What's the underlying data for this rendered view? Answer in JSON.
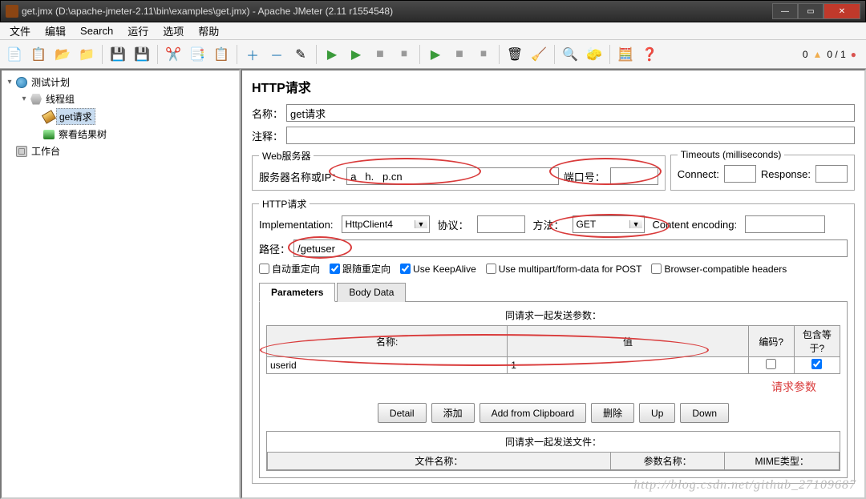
{
  "titlebar": {
    "text": "get.jmx (D:\\apache-jmeter-2.11\\bin\\examples\\get.jmx) - Apache JMeter (2.11 r1554548)"
  },
  "menubar": [
    "文件",
    "编辑",
    "Search",
    "运行",
    "选项",
    "帮助"
  ],
  "status": {
    "warn_count": "0",
    "err_count": "0 / 1"
  },
  "tree": {
    "nodes": [
      {
        "label": "测试计划",
        "indent": 0,
        "icon": "plan",
        "expanded": true
      },
      {
        "label": "线程组",
        "indent": 1,
        "icon": "thread",
        "expanded": true
      },
      {
        "label": "get请求",
        "indent": 2,
        "icon": "sampler",
        "selected": true
      },
      {
        "label": "察看结果树",
        "indent": 2,
        "icon": "listener"
      },
      {
        "label": "工作台",
        "indent": 0,
        "icon": "workbench"
      }
    ]
  },
  "page": {
    "title": "HTTP请求",
    "name_label": "名称：",
    "name_value": "get请求",
    "comment_label": "注释：",
    "comment_value": ""
  },
  "webserver": {
    "legend": "Web服务器",
    "server_label": "服务器名称或IP：",
    "server_value": "a   h.   p.cn",
    "port_label": "端口号：",
    "port_value": ""
  },
  "timeouts": {
    "legend": "Timeouts (milliseconds)",
    "connect_label": "Connect:",
    "connect_value": "",
    "response_label": "Response:",
    "response_value": ""
  },
  "httpreq": {
    "legend": "HTTP请求",
    "impl_label": "Implementation:",
    "impl_value": "HttpClient4",
    "protocol_label": "协议：",
    "protocol_value": "",
    "method_label": "方法：",
    "method_value": "GET",
    "encoding_label": "Content encoding:",
    "encoding_value": "",
    "path_label": "路径：",
    "path_value": "/getuser",
    "chk_autoredirect": "自动重定向",
    "chk_followredirect": "跟随重定向",
    "chk_keepalive": "Use KeepAlive",
    "chk_multipart": "Use multipart/form-data for POST",
    "chk_browsercompat": "Browser-compatible headers"
  },
  "tabs": {
    "parameters": "Parameters",
    "bodydata": "Body Data"
  },
  "params": {
    "section_title": "同请求一起发送参数：",
    "headers": {
      "name": "名称:",
      "value": "值",
      "encode": "编码?",
      "include": "包含等于?"
    },
    "rows": [
      {
        "name": "userid",
        "value": "1",
        "encode": false,
        "include": true
      }
    ],
    "annotation": "请求参数"
  },
  "buttons": {
    "detail": "Detail",
    "add": "添加",
    "clipboard": "Add from Clipboard",
    "delete": "删除",
    "up": "Up",
    "down": "Down"
  },
  "files": {
    "section_title": "同请求一起发送文件：",
    "col_file": "文件名称：",
    "col_param": "参数名称：",
    "col_mime": "MIME类型："
  },
  "watermark": "http://blog.csdn.net/github_27109687"
}
